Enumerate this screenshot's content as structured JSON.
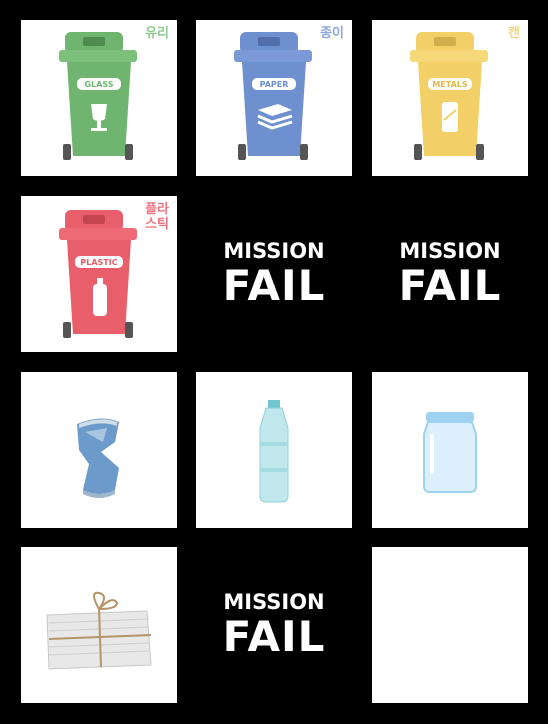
{
  "cards": {
    "glass": {
      "korean": "유리",
      "label": "GLASS",
      "color": "#6fb56f"
    },
    "paper": {
      "korean": "종이",
      "label": "PAPER",
      "color": "#6f90cf"
    },
    "metals": {
      "korean": "캔",
      "label": "METALS",
      "color": "#f3cf68"
    },
    "plastic": {
      "korean": "플라\n스틱",
      "label": "PLASTIC",
      "color": "#e85e6a"
    }
  },
  "fail": {
    "line1": "MISSION",
    "line2": "FAIL"
  },
  "items": [
    "crushed-can",
    "plastic-bottle",
    "glass-jar",
    "newspaper-bundle",
    "empty"
  ]
}
